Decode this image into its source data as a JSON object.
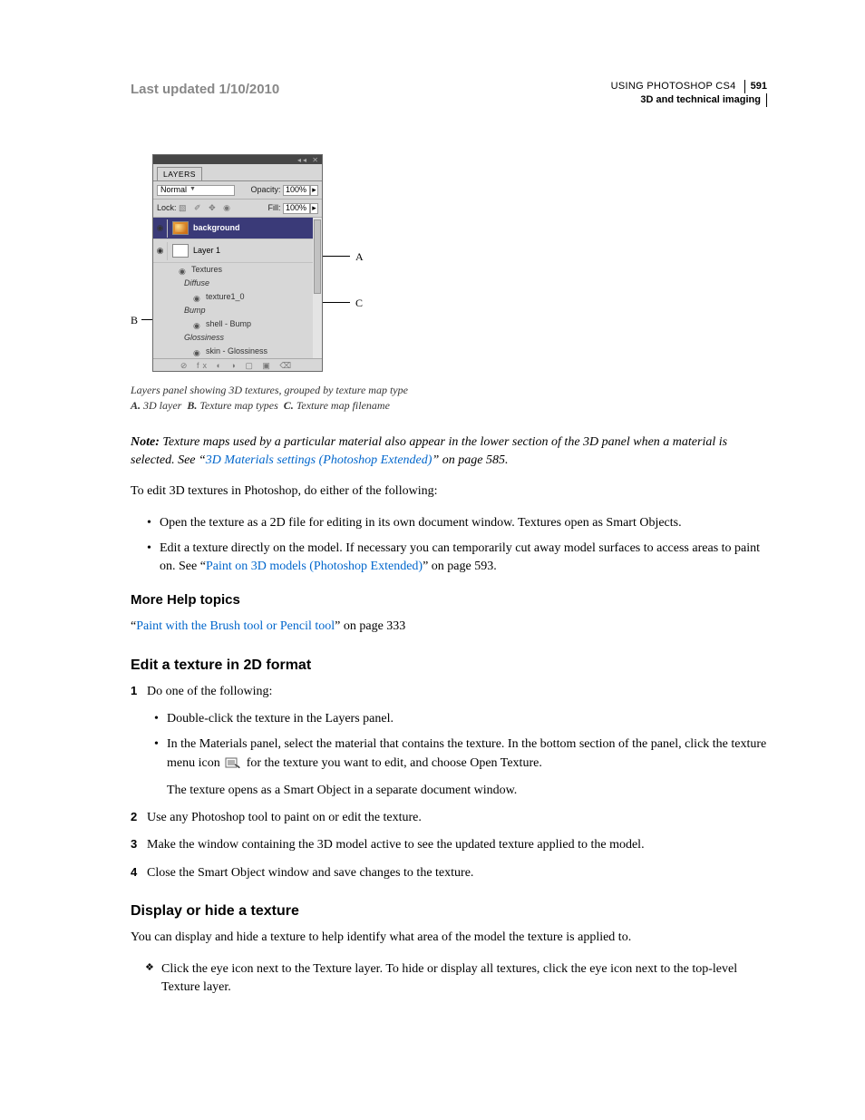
{
  "header": {
    "last_updated": "Last updated 1/10/2010",
    "product": "USING PHOTOSHOP CS4",
    "page_number": "591",
    "section": "3D and technical imaging"
  },
  "panel": {
    "tab": "LAYERS",
    "blend_mode": "Normal",
    "opacity_label": "Opacity:",
    "opacity_value": "100%",
    "lock_label": "Lock:",
    "fill_label": "Fill:",
    "fill_value": "100%",
    "layer_background": "background",
    "layer_1": "Layer 1",
    "textures": "Textures",
    "diffuse": "Diffuse",
    "texture1": "texture1_0",
    "bump": "Bump",
    "shell_bump": "shell - Bump",
    "glossiness": "Glossiness",
    "skin_gloss": "skin - Glossiness"
  },
  "callouts": {
    "A": "A",
    "B": "B",
    "C": "C"
  },
  "caption": {
    "line1": "Layers panel showing 3D textures, grouped by texture map type",
    "A_label": "A.",
    "A_text": "3D layer",
    "B_label": "B.",
    "B_text": "Texture map types",
    "C_label": "C.",
    "C_text": "Texture map filename"
  },
  "note": {
    "label": "Note:",
    "text_before_link": " Texture maps used by a particular material also appear in the lower section of the 3D panel when a material is selected. See “",
    "link": "3D Materials settings (Photoshop Extended)",
    "text_after_link": "” on page 585."
  },
  "intro": "To edit 3D textures in Photoshop, do either of the following:",
  "bullets": {
    "b1": "Open the texture as a 2D file for editing in its own document window. Textures open as Smart Objects.",
    "b2_before": "Edit a texture directly on the model. If necessary you can temporarily cut away model surfaces to access areas to paint on. See “",
    "b2_link": "Paint on 3D models (Photoshop Extended)",
    "b2_after": "” on page 593."
  },
  "more_help": {
    "heading": "More Help topics",
    "q1": "“",
    "link": "Paint with the Brush tool or Pencil tool",
    "q2": "” on page 333"
  },
  "section_edit": {
    "heading": "Edit a texture in 2D format",
    "s1": "Do one of the following:",
    "s1a": "Double-click the texture in the Layers panel.",
    "s1b_before": "In the Materials panel, select the material that contains the texture. In the bottom section of the panel, click the texture menu icon ",
    "s1b_after": " for the texture you want to edit, and choose Open Texture.",
    "s1_result": "The texture opens as a Smart Object in a separate document window.",
    "s2": "Use any Photoshop tool to paint on or edit the texture.",
    "s3": "Make the window containing the 3D model active to see the updated texture applied to the model.",
    "s4": "Close the Smart Object window and save changes to the texture."
  },
  "section_display": {
    "heading": "Display or hide a texture",
    "intro": "You can display and hide a texture to help identify what area of the model the texture is applied to.",
    "item": "Click the eye icon next to the Texture layer. To hide or display all textures, click the eye icon next to the top-level Texture layer."
  }
}
